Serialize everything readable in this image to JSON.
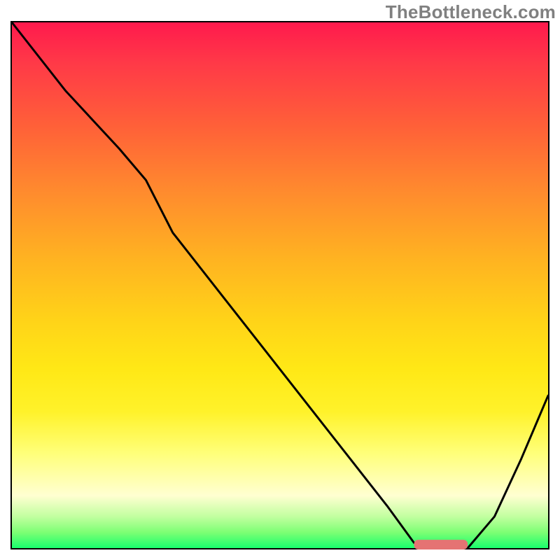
{
  "watermark": "TheBottleneck.com",
  "chart_data": {
    "type": "line",
    "title": "",
    "xlabel": "",
    "ylabel": "",
    "watermark": "TheBottleneck.com",
    "xlim": [
      0,
      100
    ],
    "ylim": [
      0,
      100
    ],
    "x": [
      0,
      10,
      20,
      25,
      30,
      40,
      50,
      60,
      70,
      75,
      80,
      85,
      90,
      95,
      100
    ],
    "values": [
      100,
      87,
      76,
      70,
      60,
      47,
      34,
      21,
      8,
      1,
      0,
      0,
      6,
      17,
      29
    ],
    "marker": {
      "x_start": 75,
      "x_end": 85,
      "y": 0
    },
    "background_gradient": {
      "top": "#ff1a4d",
      "mid": "#ffd418",
      "bottom": "#19ff6d"
    }
  }
}
